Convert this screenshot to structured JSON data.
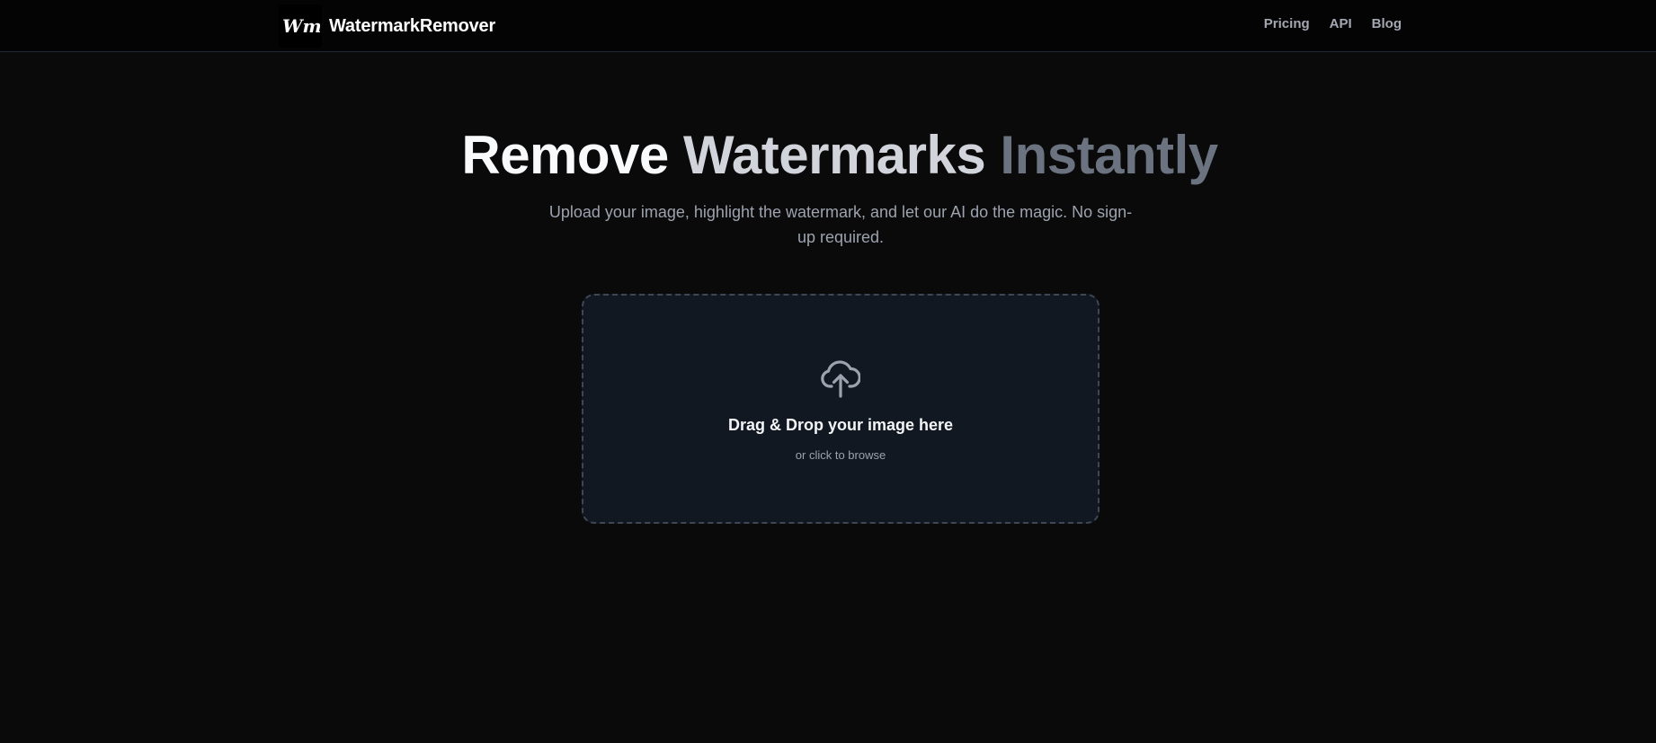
{
  "header": {
    "logo_text": "Wm",
    "brand_name": "WatermarkRemover",
    "nav": [
      {
        "label": "Pricing"
      },
      {
        "label": "API"
      },
      {
        "label": "Blog"
      }
    ]
  },
  "hero": {
    "title_parts": [
      "Remove",
      "Watermarks",
      "Instantly"
    ],
    "subtitle": "Upload your image, highlight the watermark, and let our AI do the magic. No sign-up required."
  },
  "dropzone": {
    "icon": "cloud-upload-icon",
    "title": "Drag & Drop your image here",
    "subtitle": "or click to browse"
  },
  "colors": {
    "background": "#0a0a0a",
    "header_background": "#040404",
    "dropzone_background": "#111821",
    "dropzone_border": "#3f4755",
    "title_start": "#f9fafb",
    "title_end": "#6b7280",
    "muted_text": "#9ca3af"
  }
}
